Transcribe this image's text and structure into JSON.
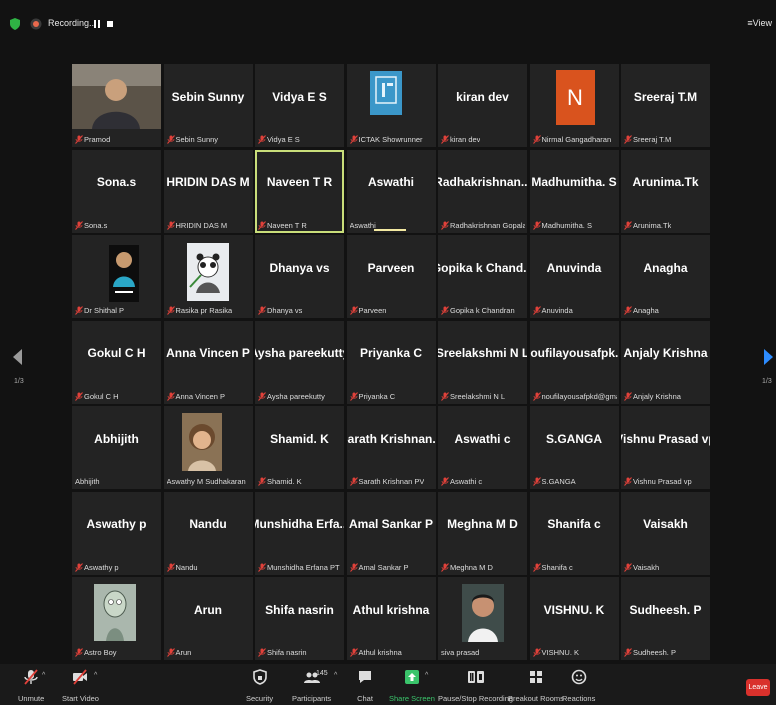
{
  "topbar": {
    "recording_label": "Recording...",
    "view_label": "View"
  },
  "pagination": {
    "left_indicator": "1/3",
    "right_indicator": "1/3"
  },
  "participants": [
    {
      "display": "",
      "label": "Pramod",
      "muted": true,
      "picture": "person-photo"
    },
    {
      "display": "Sebin Sunny",
      "label": "Sebin Sunny",
      "muted": true
    },
    {
      "display": "Vidya E S",
      "label": "Vidya E S",
      "muted": true
    },
    {
      "display": "",
      "label": "ICTAK Showrunner",
      "muted": true,
      "picture": "ictak-logo"
    },
    {
      "display": "kiran dev",
      "label": "kiran dev",
      "muted": true
    },
    {
      "display": "",
      "label": "Nirmal Gangadharan",
      "muted": true,
      "picture": "letter-avatar",
      "avatar_letter": "N"
    },
    {
      "display": "Sreeraj T.M",
      "label": "Sreeraj T.M",
      "muted": true
    },
    {
      "display": "Sona.s",
      "label": "Sona.s",
      "muted": true
    },
    {
      "display": "HRIDIN DAS M",
      "label": "HRIDIN DAS M",
      "muted": true
    },
    {
      "display": "Naveen T R",
      "label": "Naveen T R",
      "muted": true,
      "active": true
    },
    {
      "display": "Aswathi",
      "label": "Aswathi",
      "muted": false,
      "speaking": true
    },
    {
      "display": "Radhakrishnan...",
      "label": "Radhakrishnan Gopalan",
      "muted": true
    },
    {
      "display": "Madhumitha. S",
      "label": "Madhumitha. S",
      "muted": true
    },
    {
      "display": "Arunima.Tk",
      "label": "Arunima.Tk",
      "muted": true
    },
    {
      "display": "",
      "label": "Dr Shithal P",
      "muted": true,
      "picture": "person-photo"
    },
    {
      "display": "",
      "label": "Rasika pr Rasika",
      "muted": true,
      "picture": "panda-photo"
    },
    {
      "display": "Dhanya vs",
      "label": "Dhanya vs",
      "muted": true
    },
    {
      "display": "Parveen",
      "label": "Parveen",
      "muted": true
    },
    {
      "display": "Gopika k Chand...",
      "label": "Gopika k Chandran",
      "muted": true
    },
    {
      "display": "Anuvinda",
      "label": "Anuvinda",
      "muted": true
    },
    {
      "display": "Anagha",
      "label": "Anagha",
      "muted": true
    },
    {
      "display": "Gokul C H",
      "label": "Gokul C H",
      "muted": true
    },
    {
      "display": "Anna Vincen P",
      "label": "Anna Vincen P",
      "muted": true
    },
    {
      "display": "Aysha pareekutty",
      "label": "Aysha pareekutty",
      "muted": true
    },
    {
      "display": "Priyanka C",
      "label": "Priyanka C",
      "muted": true
    },
    {
      "display": "Sreelakshmi N L",
      "label": "Sreelakshmi N L",
      "muted": true
    },
    {
      "display": "noufilayousafpk...",
      "label": "noufilayousafpkd@gmail...",
      "muted": true
    },
    {
      "display": "Anjaly Krishna",
      "label": "Anjaly Krishna",
      "muted": true
    },
    {
      "display": "Abhijith",
      "label": "Abhijith",
      "muted": false
    },
    {
      "display": "",
      "label": "Aswathy M Sudhakaran",
      "muted": false,
      "picture": "child-photo"
    },
    {
      "display": "Shamid. K",
      "label": "Shamid. K",
      "muted": true
    },
    {
      "display": "Sarath Krishnan...",
      "label": "Sarath Krishnan PV",
      "muted": true
    },
    {
      "display": "Aswathi c",
      "label": "Aswathi c",
      "muted": true
    },
    {
      "display": "S.GANGA",
      "label": "S.GANGA",
      "muted": true
    },
    {
      "display": "Vishnu Prasad vp",
      "label": "Vishnu Prasad vp",
      "muted": true
    },
    {
      "display": "Aswathy p",
      "label": "Aswathy p",
      "muted": true
    },
    {
      "display": "Nandu",
      "label": "Nandu",
      "muted": true
    },
    {
      "display": "Munshidha Erfa...",
      "label": "Munshidha Erfana PT",
      "muted": true
    },
    {
      "display": "Amal Sankar P",
      "label": "Amal Sankar P",
      "muted": true
    },
    {
      "display": "Meghna M D",
      "label": "Meghna M D",
      "muted": true
    },
    {
      "display": "Shanifa c",
      "label": "Shanifa c",
      "muted": true
    },
    {
      "display": "Vaisakh",
      "label": "Vaisakh",
      "muted": true
    },
    {
      "display": "",
      "label": "Astro Boy",
      "muted": true,
      "picture": "cartoon-photo"
    },
    {
      "display": "Arun",
      "label": "Arun",
      "muted": true
    },
    {
      "display": "Shifa nasrin",
      "label": "Shifa nasrin",
      "muted": true
    },
    {
      "display": "Athul krishna",
      "label": "Athul krishna",
      "muted": true
    },
    {
      "display": "",
      "label": "siva prasad",
      "muted": false,
      "picture": "person-photo"
    },
    {
      "display": "VISHNU. K",
      "label": "VISHNU. K",
      "muted": true
    },
    {
      "display": "Sudheesh. P",
      "label": "Sudheesh. P",
      "muted": true
    }
  ],
  "toolbar": {
    "unmute": "Unmute",
    "start_video": "Start Video",
    "security": "Security",
    "participants": "Participants",
    "participants_count": "145",
    "chat": "Chat",
    "share_screen": "Share Screen",
    "pause_recording": "Pause/Stop Recording",
    "breakout_rooms": "Breakout Rooms",
    "reactions": "Reactions",
    "leave": "Leave"
  },
  "colors": {
    "background": "#121212",
    "tile": "#232323",
    "active_speaker_border": "#c9de7a",
    "muted_icon": "#e0413a",
    "share_green": "#3ac46b",
    "leave_red": "#d9312c",
    "nav_arrow": "#2d8cff",
    "avatar_orange": "#d9531e"
  }
}
